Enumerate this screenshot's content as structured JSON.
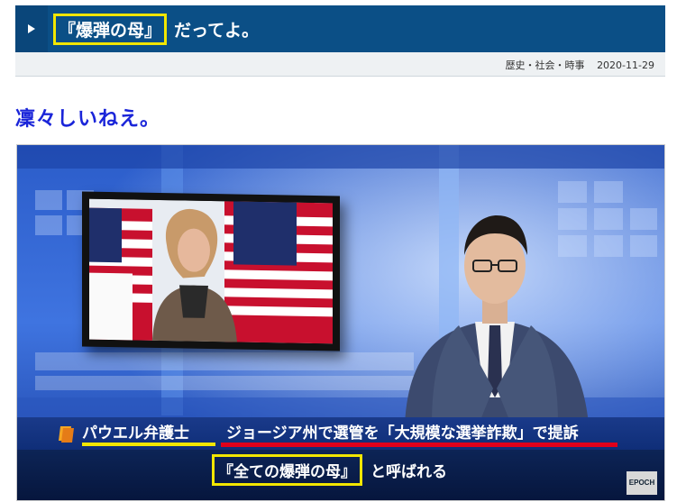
{
  "post": {
    "title_highlight": "『爆弾の母』",
    "title_rest": "だってよ。",
    "category": "歴史・社会・時事",
    "date": "2020-11-29"
  },
  "heading": "凜々しいねえ。",
  "video": {
    "ticker_name": "パウエル弁護士",
    "ticker_headline": "ジョージア州で選管を「大規模な選挙詐欺」で提訴",
    "subtitle_highlight": "『全ての爆弾の母』",
    "subtitle_rest": "と呼ばれる",
    "logo_text": "EPOCH"
  },
  "colors": {
    "header_bg": "#0b4f86",
    "heading_text": "#1a25d9",
    "highlight": "#f2e600",
    "ticker_red": "#e0001b"
  },
  "icons": [
    "play-triangle-icon",
    "ticker-flag-icon"
  ]
}
